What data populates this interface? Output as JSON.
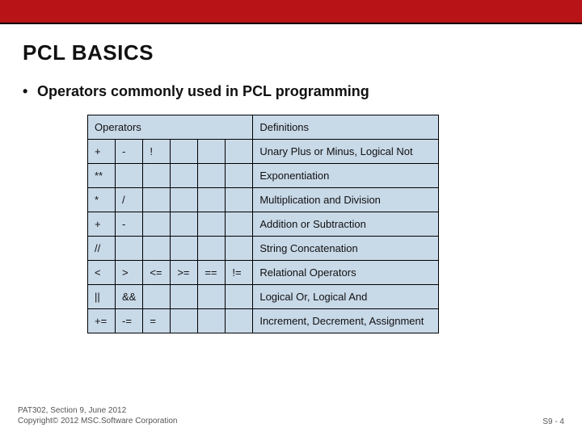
{
  "title": "PCL BASICS",
  "bullet": "Operators commonly used in PCL programming",
  "headers": {
    "operators": "Operators",
    "definitions": "Definitions"
  },
  "rows": [
    {
      "ops": [
        "+",
        "-",
        "!",
        "",
        "",
        ""
      ],
      "def": "Unary Plus or Minus, Logical Not"
    },
    {
      "ops": [
        "**",
        "",
        "",
        "",
        "",
        ""
      ],
      "def": "Exponentiation"
    },
    {
      "ops": [
        "*",
        "/",
        "",
        "",
        "",
        ""
      ],
      "def": "Multiplication and Division"
    },
    {
      "ops": [
        "+",
        "-",
        "",
        "",
        "",
        ""
      ],
      "def": "Addition or Subtraction"
    },
    {
      "ops": [
        "//",
        "",
        "",
        "",
        "",
        ""
      ],
      "def": "String Concatenation"
    },
    {
      "ops": [
        "<",
        ">",
        "<=",
        ">=",
        "==",
        "!="
      ],
      "def": "Relational Operators"
    },
    {
      "ops": [
        "||",
        "&&",
        "",
        "",
        "",
        ""
      ],
      "def": "Logical Or, Logical And"
    },
    {
      "ops": [
        "+=",
        "-=",
        "=",
        "",
        "",
        ""
      ],
      "def": "Increment, Decrement, Assignment"
    }
  ],
  "footer": {
    "line1": "PAT302, Section 9, June 2012",
    "line2": "Copyright© 2012 MSC.Software Corporation",
    "page": "S9 - 4"
  }
}
